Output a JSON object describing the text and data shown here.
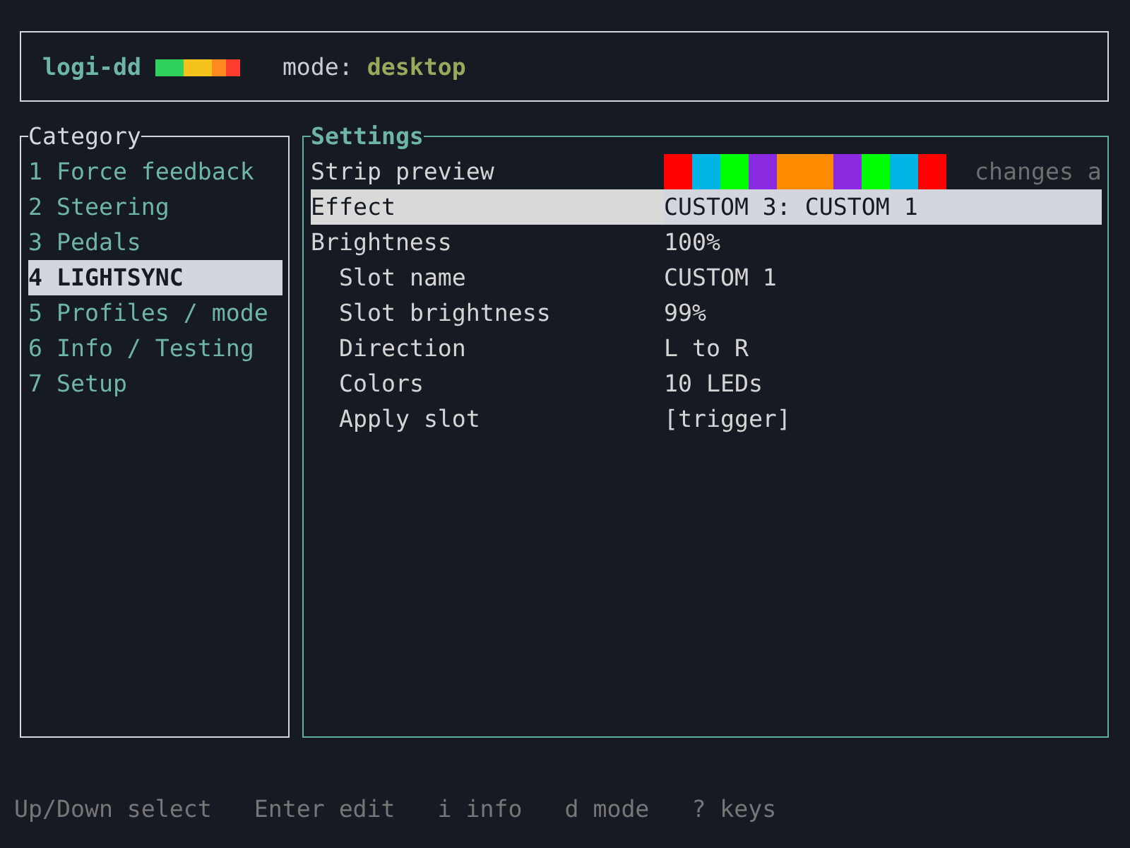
{
  "header": {
    "app_name": "logi-dd",
    "mode_label": "mode:",
    "mode_value": "desktop"
  },
  "category_panel": {
    "title": "Category",
    "items": [
      {
        "label": "1 Force feedback",
        "selected": false
      },
      {
        "label": "2 Steering",
        "selected": false
      },
      {
        "label": "3 Pedals",
        "selected": false
      },
      {
        "label": "4 LIGHTSYNC",
        "selected": true
      },
      {
        "label": "5 Profiles / mode",
        "selected": false
      },
      {
        "label": "6 Info / Testing",
        "selected": false
      },
      {
        "label": "7 Setup",
        "selected": false
      }
    ]
  },
  "settings_panel": {
    "title": "Settings",
    "rows": [
      {
        "kind": "strip",
        "label": "Strip preview",
        "selected": false,
        "leds": [
          {
            "color": "#ff0000"
          },
          {
            "color": "#00b4e6"
          },
          {
            "color": "#00ff00"
          },
          {
            "color": "#8a2be2"
          },
          {
            "color": "#ff8c00"
          },
          {
            "color": "#ff8c00"
          },
          {
            "color": "#8a2be2"
          },
          {
            "color": "#00ff00"
          },
          {
            "color": "#00b4e6"
          },
          {
            "color": "#ff0000"
          }
        ],
        "hint": "changes a"
      },
      {
        "kind": "value",
        "label": "Effect",
        "value": "CUSTOM 3: CUSTOM 1",
        "selected": true
      },
      {
        "kind": "value",
        "label": "Brightness",
        "value": "100%",
        "selected": false,
        "children": [
          {
            "kind": "value",
            "label": "Slot name",
            "value": "CUSTOM 1",
            "selected": false
          },
          {
            "kind": "value",
            "label": "Slot brightness",
            "value": "99%",
            "selected": false
          },
          {
            "kind": "value",
            "label": "Direction",
            "value": "L to R",
            "selected": false
          },
          {
            "kind": "value",
            "label": "Colors",
            "value": "10 LEDs",
            "selected": false
          },
          {
            "kind": "value",
            "label": "Apply slot",
            "value": "[trigger]",
            "selected": false
          }
        ]
      }
    ]
  },
  "status_bar": [
    "Up/Down select",
    "Enter edit",
    "i info",
    "d mode",
    "? keys"
  ]
}
